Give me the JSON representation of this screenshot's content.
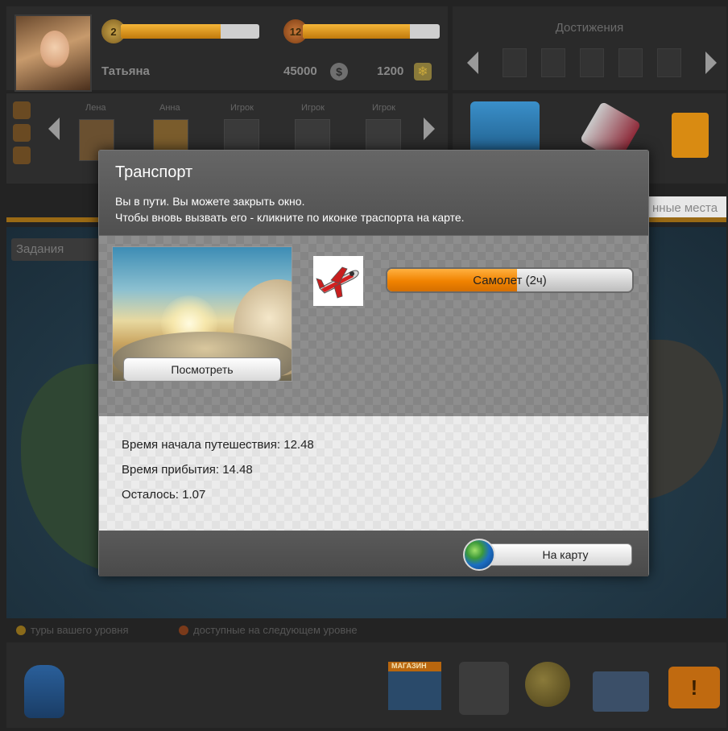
{
  "profile": {
    "name": "Татьяна",
    "level": "2",
    "level_progress": 0.72,
    "hearts": "12",
    "hearts_progress": 0.78,
    "coins": "45000",
    "coin_symbol": "$",
    "snowflakes": "1200"
  },
  "achievements": {
    "title": "Достижения"
  },
  "friends": [
    {
      "name": "Лена"
    },
    {
      "name": "Анна"
    },
    {
      "name": "Игрок"
    },
    {
      "name": "Игрок"
    },
    {
      "name": "Игрок"
    }
  ],
  "tasks_dropdown": "Задания",
  "places_tab": "нные места",
  "legend": {
    "item1": "туры вашего уровня",
    "item2": "доступные на следующем уровне"
  },
  "bottom": {
    "shop_label": "МАГАЗИН"
  },
  "dialog": {
    "title": "Транспорт",
    "subtitle_line1": "Вы в пути. Вы можете закрыть окно.",
    "subtitle_line2": "Чтобы вновь вызвать его - кликните по иконке траспорта на карте.",
    "view_button": "Посмотреть",
    "transport_icon": "airplane-icon",
    "progress_label": "Самолет (2ч)",
    "progress_fraction": 0.53,
    "info": {
      "start": "Время начала путешествия: 12.48",
      "arrival": "Время прибытия: 14.48",
      "remaining": "Осталось: 1.07"
    },
    "map_button": "На карту"
  },
  "colors": {
    "accent_orange": "#f08200",
    "dialog_bg": "#585858"
  }
}
